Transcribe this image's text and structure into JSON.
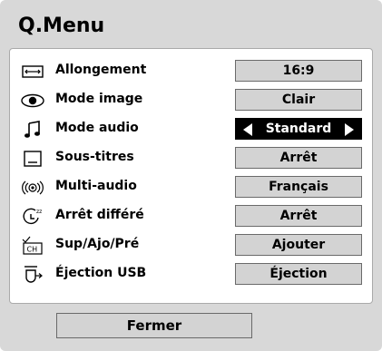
{
  "menu": {
    "title": "Q.Menu",
    "close_label": "Fermer",
    "items": [
      {
        "icon": "aspect-ratio-icon",
        "label": "Allongement",
        "value": "16:9",
        "selected": false
      },
      {
        "icon": "eye-icon",
        "label": "Mode image",
        "value": "Clair",
        "selected": false
      },
      {
        "icon": "music-note-icon",
        "label": "Mode audio",
        "value": "Standard",
        "selected": true
      },
      {
        "icon": "subtitle-icon",
        "label": "Sous-titres",
        "value": "Arrêt",
        "selected": false
      },
      {
        "icon": "multi-audio-icon",
        "label": "Multi-audio",
        "value": "Français",
        "selected": false
      },
      {
        "icon": "sleep-timer-icon",
        "label": "Arrêt différé",
        "value": "Arrêt",
        "selected": false
      },
      {
        "icon": "channel-icon",
        "label": "Sup/Ajo/Pré",
        "value": "Ajouter",
        "selected": false
      },
      {
        "icon": "usb-eject-icon",
        "label": "Éjection USB",
        "value": "Éjection",
        "selected": false
      }
    ]
  },
  "colors": {
    "window_bg": "#d8d8d8",
    "panel_bg": "#ffffff",
    "value_bg": "#d3d3d3",
    "selected_bg": "#000000",
    "selected_text": "#ffffff"
  }
}
